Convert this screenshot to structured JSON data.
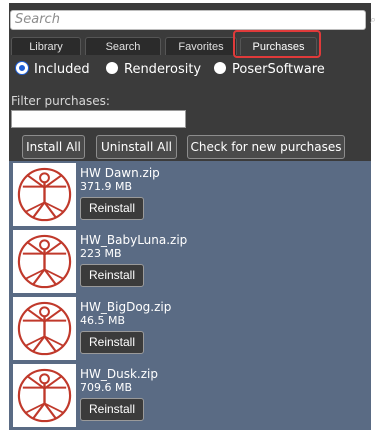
{
  "search": {
    "placeholder": "Search",
    "icon": "search-icon"
  },
  "tabs": [
    {
      "label": "Library"
    },
    {
      "label": "Search"
    },
    {
      "label": "Favorites"
    },
    {
      "label": "Purchases",
      "active": true
    }
  ],
  "source_filter": {
    "options": [
      {
        "label": "Included",
        "selected": true
      },
      {
        "label": "Renderosity",
        "selected": false
      },
      {
        "label": "PoserSoftware",
        "selected": false
      }
    ]
  },
  "filter": {
    "label": "Filter purchases:",
    "value": ""
  },
  "actions": {
    "install_all": "Install All",
    "uninstall_all": "Uninstall All",
    "check_new": "Check for new purchases"
  },
  "purchases": [
    {
      "name": "HW Dawn.zip",
      "size": "371.9 MB",
      "button": "Reinstall",
      "icon": "vitruvian-man-icon"
    },
    {
      "name": "HW_BabyLuna.zip",
      "size": "223 MB",
      "button": "Reinstall",
      "icon": "vitruvian-man-icon"
    },
    {
      "name": "HW_BigDog.zip",
      "size": "46.5 MB",
      "button": "Reinstall",
      "icon": "vitruvian-man-icon"
    },
    {
      "name": "HW_Dusk.zip",
      "size": "709.6 MB",
      "button": "Reinstall",
      "icon": "vitruvian-man-icon"
    }
  ],
  "colors": {
    "panel_dark": "#3b3b3b",
    "list_background": "#5a6b84",
    "highlight": "#e03a3a",
    "radio_selected": "#1f5fd6",
    "thumb_icon": "#c0392b"
  }
}
